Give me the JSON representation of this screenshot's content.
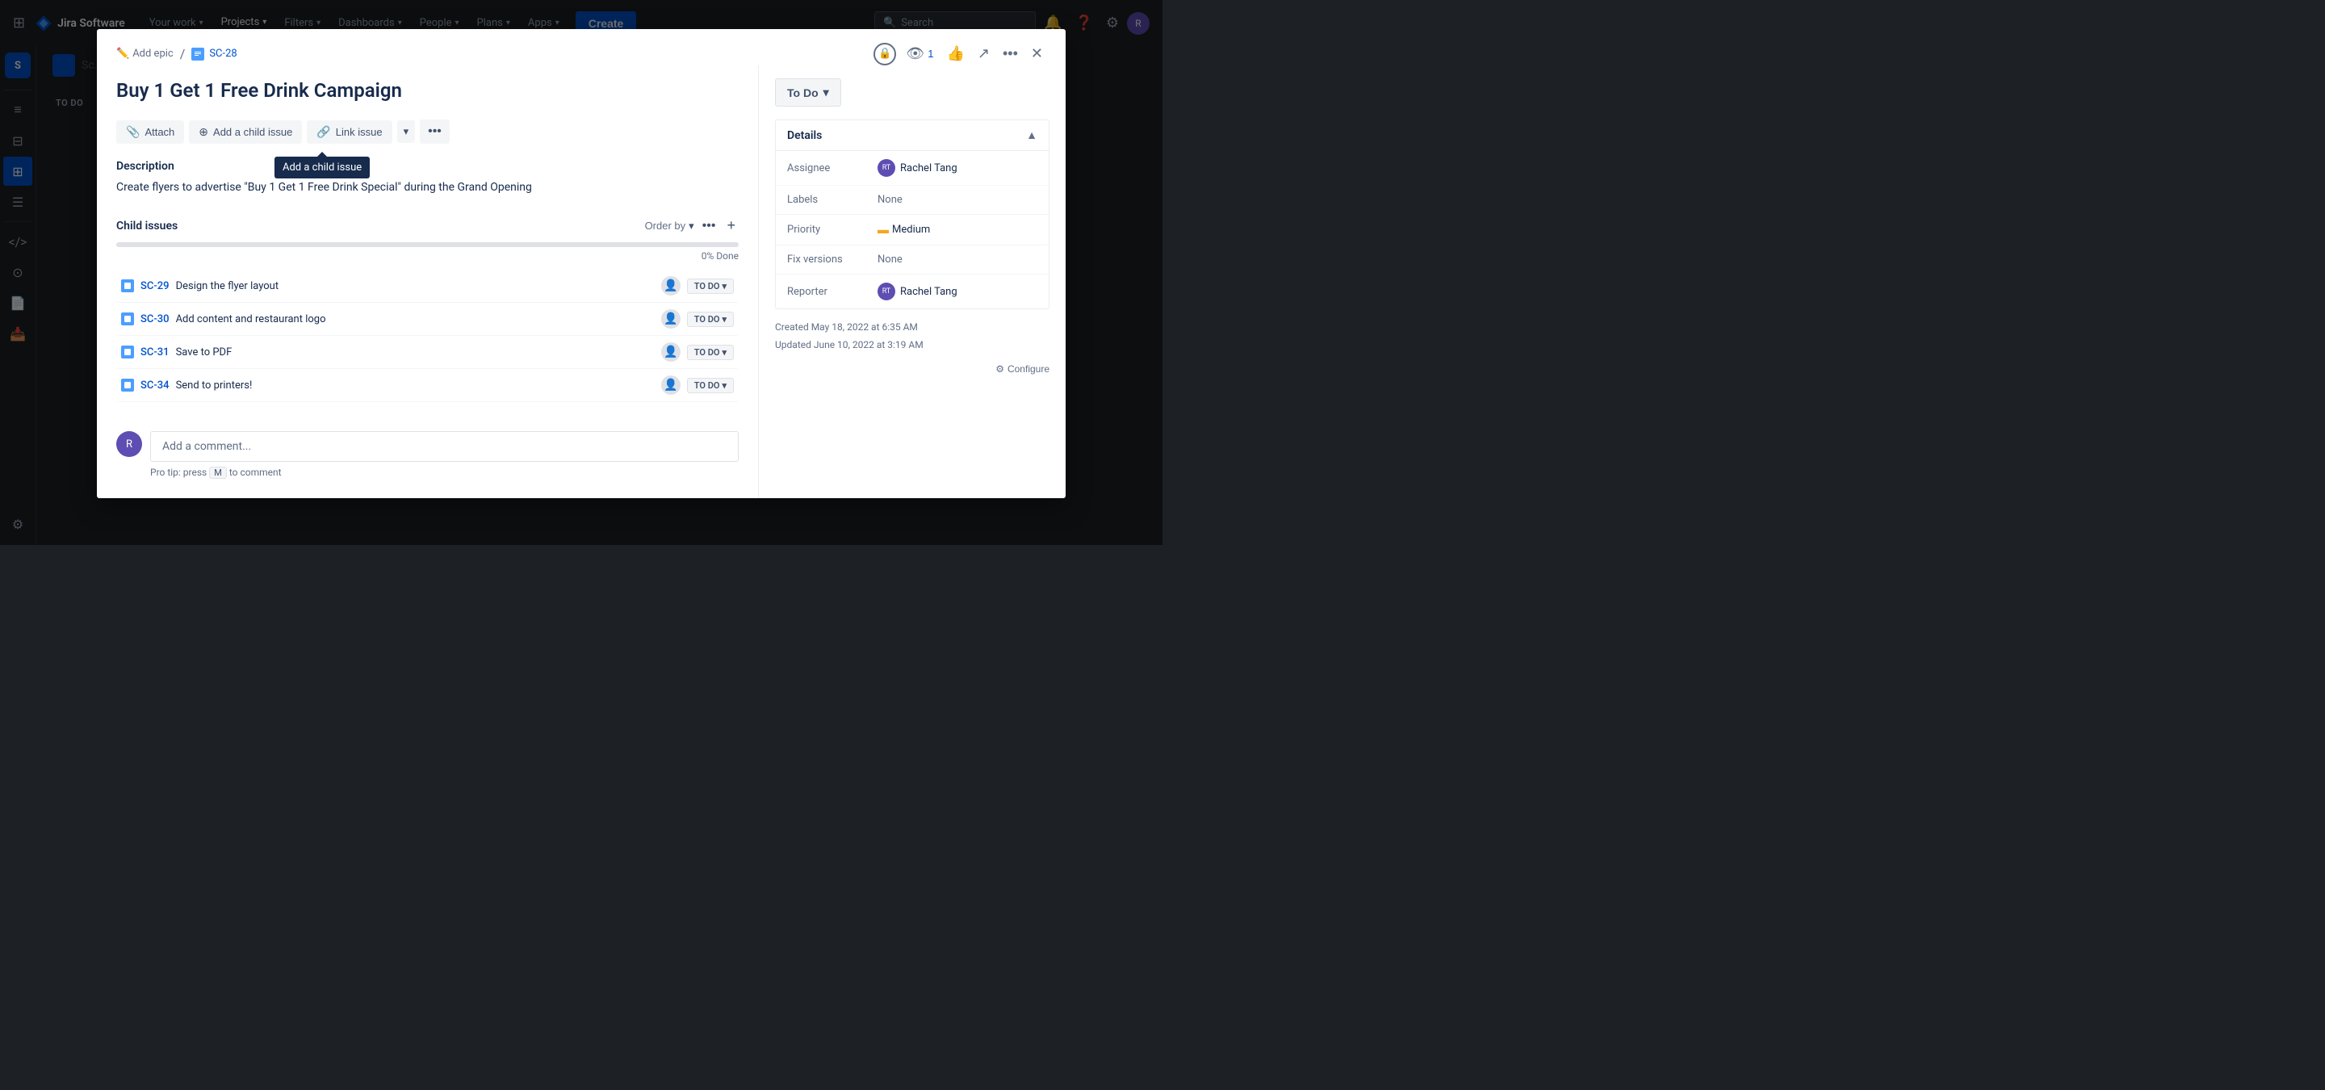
{
  "topnav": {
    "brand": "Jira Software",
    "nav_items": [
      {
        "label": "Your work",
        "active": false
      },
      {
        "label": "Projects",
        "active": true
      },
      {
        "label": "Filters",
        "active": false
      },
      {
        "label": "Dashboards",
        "active": false
      },
      {
        "label": "People",
        "active": false
      },
      {
        "label": "Plans",
        "active": false
      },
      {
        "label": "Apps",
        "active": false
      }
    ],
    "create_label": "Create",
    "search_placeholder": "Search"
  },
  "sidebar": {
    "project_short": "S",
    "items": [
      {
        "icon": "≡",
        "label": "Roadmap",
        "active": false
      },
      {
        "icon": "⬛",
        "label": "Backlog",
        "active": false
      },
      {
        "icon": "⊞",
        "label": "Board",
        "active": true
      },
      {
        "icon": "≡",
        "label": "Issues",
        "active": false
      },
      {
        "icon": "</>",
        "label": "Code",
        "active": false
      },
      {
        "icon": "⊙",
        "label": "Releases",
        "active": false
      },
      {
        "icon": "📄",
        "label": "Project pages",
        "active": false
      },
      {
        "icon": "📥",
        "label": "Add shortcut",
        "active": false
      },
      {
        "icon": "⚙",
        "label": "Project settings",
        "active": false
      }
    ]
  },
  "modal": {
    "breadcrumb_add_epic": "Add epic",
    "breadcrumb_issue_key": "SC-28",
    "title": "Buy 1 Get 1 Free Drink Campaign",
    "toolbar": {
      "attach_label": "Attach",
      "add_child_label": "Add a child issue",
      "link_issue_label": "Link issue",
      "tooltip_text": "Add a child issue"
    },
    "description_label": "Description",
    "description_text": "Create flyers to advertise \"Buy 1 Get 1 Free Drink Special\" during the Grand Opening",
    "child_issues": {
      "section_title": "Child issues",
      "order_by_label": "Order by",
      "progress_percent": "0% Done",
      "progress_value": 0,
      "items": [
        {
          "key": "SC-29",
          "title": "Design the flyer layout",
          "status": "TO DO"
        },
        {
          "key": "SC-30",
          "title": "Add content and restaurant logo",
          "status": "TO DO"
        },
        {
          "key": "SC-31",
          "title": "Save to PDF",
          "status": "TO DO"
        },
        {
          "key": "SC-34",
          "title": "Send to printers!",
          "status": "TO DO"
        }
      ]
    },
    "comment_placeholder": "Add a comment...",
    "pro_tip_text": "Pro tip: press",
    "pro_tip_key": "M",
    "pro_tip_suffix": "to comment",
    "status_btn_label": "To Do",
    "details": {
      "section_title": "Details",
      "assignee_label": "Assignee",
      "assignee_value": "Rachel Tang",
      "labels_label": "Labels",
      "labels_value": "None",
      "priority_label": "Priority",
      "priority_value": "Medium",
      "fix_versions_label": "Fix versions",
      "fix_versions_value": "None",
      "reporter_label": "Reporter",
      "reporter_value": "Rachel Tang",
      "created_text": "Created May 18, 2022 at 6:35 AM",
      "updated_text": "Updated June 10, 2022 at 3:19 AM",
      "configure_label": "Configure"
    },
    "watch_count": "1"
  }
}
